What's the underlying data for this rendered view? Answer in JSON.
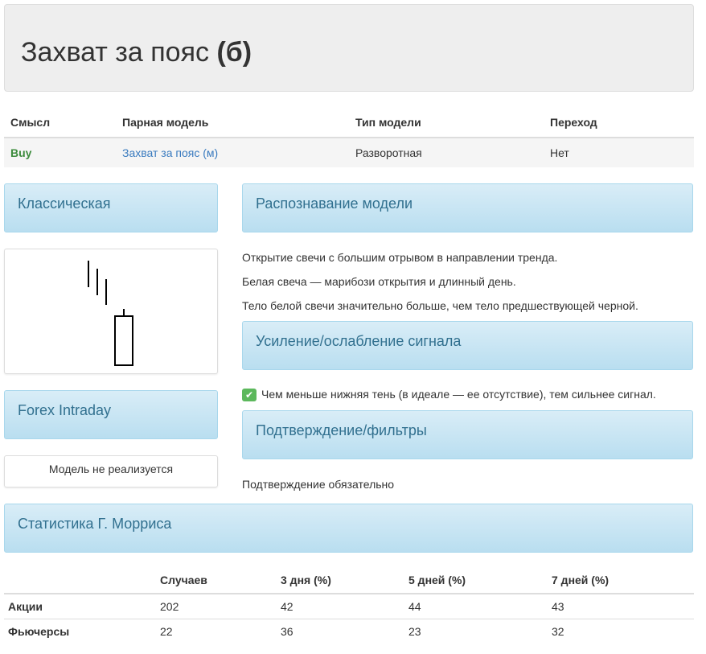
{
  "header": {
    "title_main": "Захват за пояс",
    "title_bold": "(б)"
  },
  "info_table": {
    "columns": [
      "Смысл",
      "Парная модель",
      "Тип модели",
      "Переход"
    ],
    "row": {
      "signal": "Buy",
      "pair": "Захват за пояс (м)",
      "type": "Разворотная",
      "transition": "Нет"
    }
  },
  "panels": {
    "classic": "Классическая",
    "recognition": "Распознавание модели",
    "signal": "Усиление/ослабление сигнала",
    "forex": "Forex Intraday",
    "confirm": "Подтверждение/фильтры",
    "stats": "Статистика Г. Морриса"
  },
  "recognition_lines": [
    "Открытие свечи с большим отрывом в направлении тренда.",
    "Белая свеча — марибози открытия и длинный день.",
    "Тело белой свечи значительно больше, чем тело предшествующей черной."
  ],
  "signal_note": "Чем меньше нижняя тень (в идеале — ее отсутствие), тем сильнее сигнал.",
  "forex_note": "Модель не реализуется",
  "confirm_note": "Подтверждение обязательно",
  "stats_table": {
    "columns": [
      "",
      "Случаев",
      "3 дня (%)",
      "5 дней (%)",
      "7 дней (%)"
    ],
    "rows": [
      [
        "Акции",
        "202",
        "42",
        "44",
        "43"
      ],
      [
        "Фьючерсы",
        "22",
        "36",
        "23",
        "32"
      ]
    ]
  }
}
